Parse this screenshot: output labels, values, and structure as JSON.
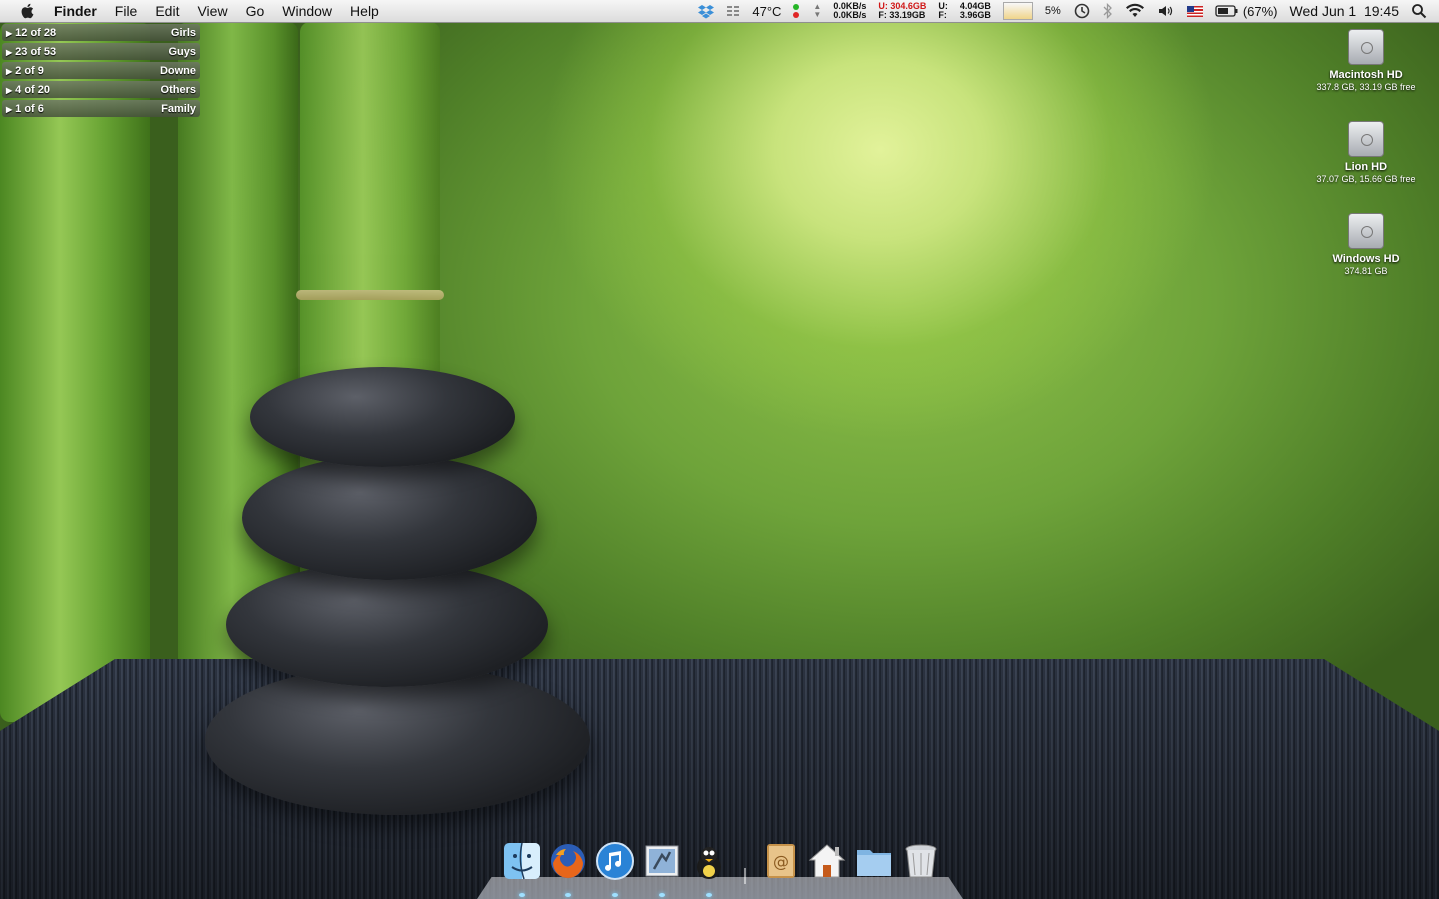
{
  "menubar": {
    "app_name": "Finder",
    "menus": [
      "File",
      "Edit",
      "View",
      "Go",
      "Window",
      "Help"
    ],
    "status": {
      "temperature": "47°C",
      "net_down": "0.0KB/s",
      "net_up": "0.0KB/s",
      "disk_u": "U: 304.6GB",
      "disk_f": "F: 33.19GB",
      "mem_u": "U:",
      "mem_f": "F:",
      "mem_total_u": "4.04GB",
      "mem_total_f": "3.96GB",
      "cpu": "5%",
      "battery": "(67%)",
      "datetime": "Wed Jun 1  19:45"
    }
  },
  "groups": [
    {
      "count": "12 of 28",
      "name": "Girls"
    },
    {
      "count": "23 of 53",
      "name": "Guys"
    },
    {
      "count": "2 of 9",
      "name": "Downe"
    },
    {
      "count": "4 of 20",
      "name": "Others"
    },
    {
      "count": "1 of 6",
      "name": "Family"
    }
  ],
  "drives": [
    {
      "name": "Macintosh HD",
      "info": "337.8 GB, 33.19 GB free"
    },
    {
      "name": "Lion HD",
      "info": "37.07 GB, 15.66 GB free"
    },
    {
      "name": "Windows HD",
      "info": "374.81 GB"
    }
  ],
  "dock": {
    "apps": [
      "finder-icon",
      "firefox-icon",
      "itunes-icon",
      "mail-icon",
      "adium-icon",
      "address-book-icon",
      "home-folder-icon",
      "documents-folder-icon",
      "trash-icon"
    ]
  }
}
